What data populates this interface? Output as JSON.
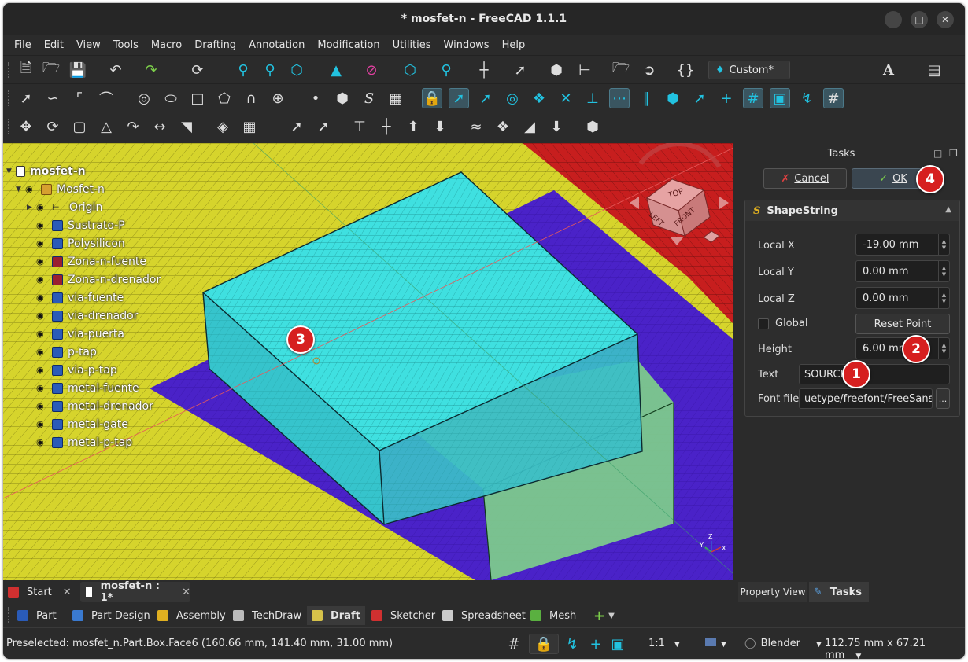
{
  "window": {
    "title": "* mosfet-n - FreeCAD 1.1.1"
  },
  "menu": [
    "File",
    "Edit",
    "View",
    "Tools",
    "Macro",
    "Drafting",
    "Annotation",
    "Modification",
    "Utilities",
    "Windows",
    "Help"
  ],
  "toolbar": {
    "workbench_selector": "Custom*"
  },
  "tree": {
    "document": "mosfet-n",
    "body": "Mosfet-n",
    "origin": "Origin",
    "items": [
      "Sustrato-P",
      "Polysilicon",
      "Zona-n-fuente",
      "Zona-n-drenador",
      "via-fuente",
      "via-drenador",
      "via-puerta",
      "p-tap",
      "via-p-tap",
      "metal-fuente",
      "metal-drenador",
      "metal-gate",
      "metal-p-tap"
    ]
  },
  "navcube": {
    "top": "TOP",
    "left": "LEFT",
    "front": "FRONT"
  },
  "axis": {
    "z": "Z",
    "y": "Y",
    "x": "X"
  },
  "tasks": {
    "title": "Tasks",
    "cancel": "Cancel",
    "ok": "OK",
    "panel_title": "ShapeString",
    "local_x_label": "Local X",
    "local_x": "-19.00 mm",
    "local_y_label": "Local Y",
    "local_y": "0.00 mm",
    "local_z_label": "Local Z",
    "local_z": "0.00 mm",
    "global_label": "Global",
    "reset_point": "Reset Point",
    "height_label": "Height",
    "height": "6.00 mm",
    "text_label": "Text",
    "text": "SOURCE",
    "font_label": "Font file",
    "font_file": "uetype/freefont/FreeSans.ttf",
    "browse": "..."
  },
  "badges": [
    "1",
    "2",
    "3",
    "4"
  ],
  "doc_tabs": {
    "start": "Start",
    "active": "mosfet-n : 1*"
  },
  "side_tabs": {
    "property": "Property View",
    "tasks": "Tasks"
  },
  "workbenches": [
    "Part",
    "Part Design",
    "Assembly",
    "TechDraw",
    "Draft",
    "Sketcher",
    "Spreadsheet",
    "Mesh"
  ],
  "status": {
    "preselected": "Preselected: mosfet_n.Part.Box.Face6 (160.66 mm, 141.40 mm, 31.00 mm)",
    "scale": "1:1",
    "navigation": "Blender",
    "dimensions": "112.75 mm x 67.21 mm"
  },
  "colors": {
    "accent": "#22c2e0",
    "badge": "#d61f1f",
    "ground": "#d6d42c",
    "plane": "#4a22c8",
    "box": "#3fe0e0"
  }
}
